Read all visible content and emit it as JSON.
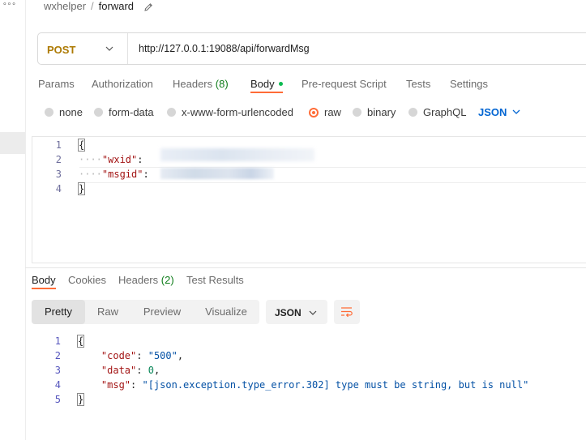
{
  "breadcrumb": {
    "parent": "wxhelper",
    "separator": "/",
    "current": "forward"
  },
  "request": {
    "method": "POST",
    "url": "http://127.0.0.1:19088/api/forwardMsg"
  },
  "request_tabs": [
    {
      "label": "Params"
    },
    {
      "label": "Authorization"
    },
    {
      "label": "Headers",
      "count": "(8)"
    },
    {
      "label": "Body"
    },
    {
      "label": "Pre-request Script"
    },
    {
      "label": "Tests"
    },
    {
      "label": "Settings"
    }
  ],
  "body_types": [
    "none",
    "form-data",
    "x-www-form-urlencoded",
    "raw",
    "binary",
    "GraphQL"
  ],
  "body_format": "JSON",
  "request_body": {
    "line_numbers": [
      "1",
      "2",
      "3",
      "4"
    ],
    "open": "{",
    "close": "}",
    "keys": [
      "\"wxid\"",
      "\"msgid\""
    ],
    "colon": ":"
  },
  "response_tabs": [
    {
      "label": "Body"
    },
    {
      "label": "Cookies"
    },
    {
      "label": "Headers",
      "count": "(2)"
    },
    {
      "label": "Test Results"
    }
  ],
  "view_modes": [
    "Pretty",
    "Raw",
    "Preview",
    "Visualize"
  ],
  "response_format": "JSON",
  "response_body": {
    "line_numbers": [
      "1",
      "2",
      "3",
      "4",
      "5"
    ],
    "open": "{",
    "close": "}",
    "lines": [
      {
        "key": "\"code\"",
        "value": "\"500\"",
        "tail": ","
      },
      {
        "key": "\"data\"",
        "value": "0",
        "tail": ","
      },
      {
        "key": "\"msg\"",
        "value": "\"[json.exception.type_error.302] type must be string, but is null\"",
        "tail": ""
      }
    ]
  },
  "colors": {
    "accent": "#ff6c37",
    "method": "#ad7a03",
    "link": "#0265d2",
    "success": "#0cbb52"
  }
}
